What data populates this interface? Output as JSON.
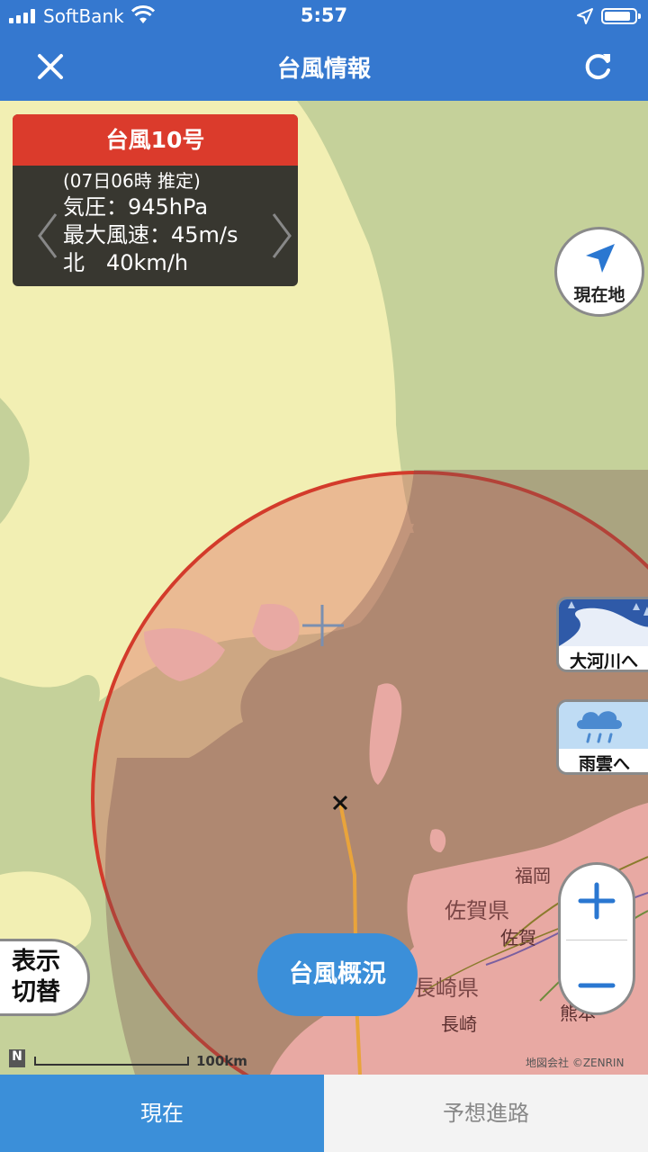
{
  "status_bar": {
    "carrier": "SoftBank",
    "time": "5:57"
  },
  "nav": {
    "title": "台風情報",
    "close_icon": "close-icon",
    "refresh_icon": "refresh-icon"
  },
  "typhoon_card": {
    "name": "台風10号",
    "time": "(07日06時 推定)",
    "pressure": "気圧：945hPa",
    "max_wind": "最大風速：45m/s",
    "movement": "北　40km/h"
  },
  "map": {
    "labels": {
      "fukuoka": "福岡",
      "saga_pref": "佐賀県",
      "saga": "佐賀",
      "nagasaki_pref": "長崎県",
      "nagasaki": "長崎",
      "kumamoto": "熊本"
    },
    "copyright": "地図会社 ©ZENRIN",
    "scale_label": "100km",
    "north_label": "N"
  },
  "buttons": {
    "current_location": "現在地",
    "big_rivers": "大河川へ",
    "rain_clouds": "雨雲へ",
    "display_toggle_line1": "表示",
    "display_toggle_line2": "切替",
    "typhoon_overview": "台風概況"
  },
  "tabs": {
    "current": "現在",
    "forecast_path": "予想進路"
  },
  "colors": {
    "brand_blue": "#3578cf",
    "tab_blue": "#3b8fd9",
    "warning_red": "#db3b2c",
    "sea": "#f2efb3",
    "land": "#c5d19a"
  }
}
